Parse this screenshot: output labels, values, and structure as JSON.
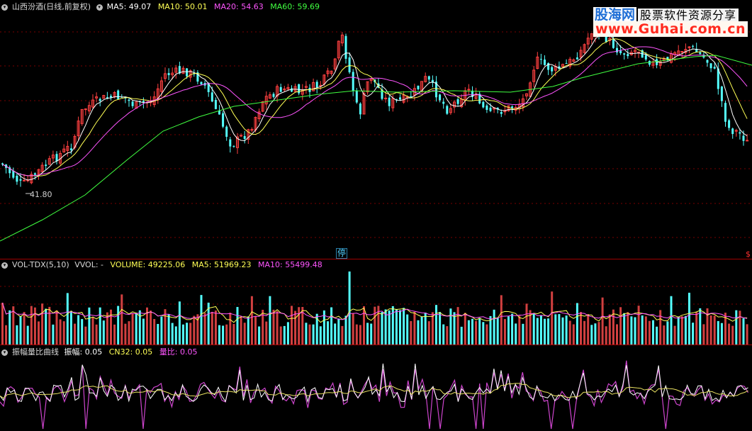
{
  "main": {
    "title": "山西汾酒(日线,前复权)",
    "ma5_label": "MA5: 49.07",
    "ma10_label": "MA10: 50.01",
    "ma20_label": "MA20: 54.63",
    "ma60_label": "MA60: 59.69",
    "low_price": "41.80",
    "stop_tag": "停",
    "right_mark": "$"
  },
  "volume": {
    "title": "VOL-TDX(5,10)",
    "vvol_label": "VVOL: -",
    "volume_label": "VOLUME: 49225.06",
    "ma5_label": "MA5: 51969.23",
    "ma10_label": "MA10: 55499.48"
  },
  "amplitude": {
    "title": "振幅量比曲线",
    "amp_label": "振幅: 0.05",
    "cn32_label": "CN32: 0.05",
    "ratio_label": "量比: 0.05"
  },
  "watermark": {
    "brand": "股海网",
    "slogan": "股票软件资源分享",
    "url": "www.Guhai.com.cn"
  },
  "colors": {
    "up": "#ff4040",
    "down": "#54ffff",
    "ma5": "#ffffff",
    "ma10": "#ffff55",
    "ma20": "#ff55ff",
    "ma60": "#40ff40",
    "grid": "#7a0000"
  }
}
